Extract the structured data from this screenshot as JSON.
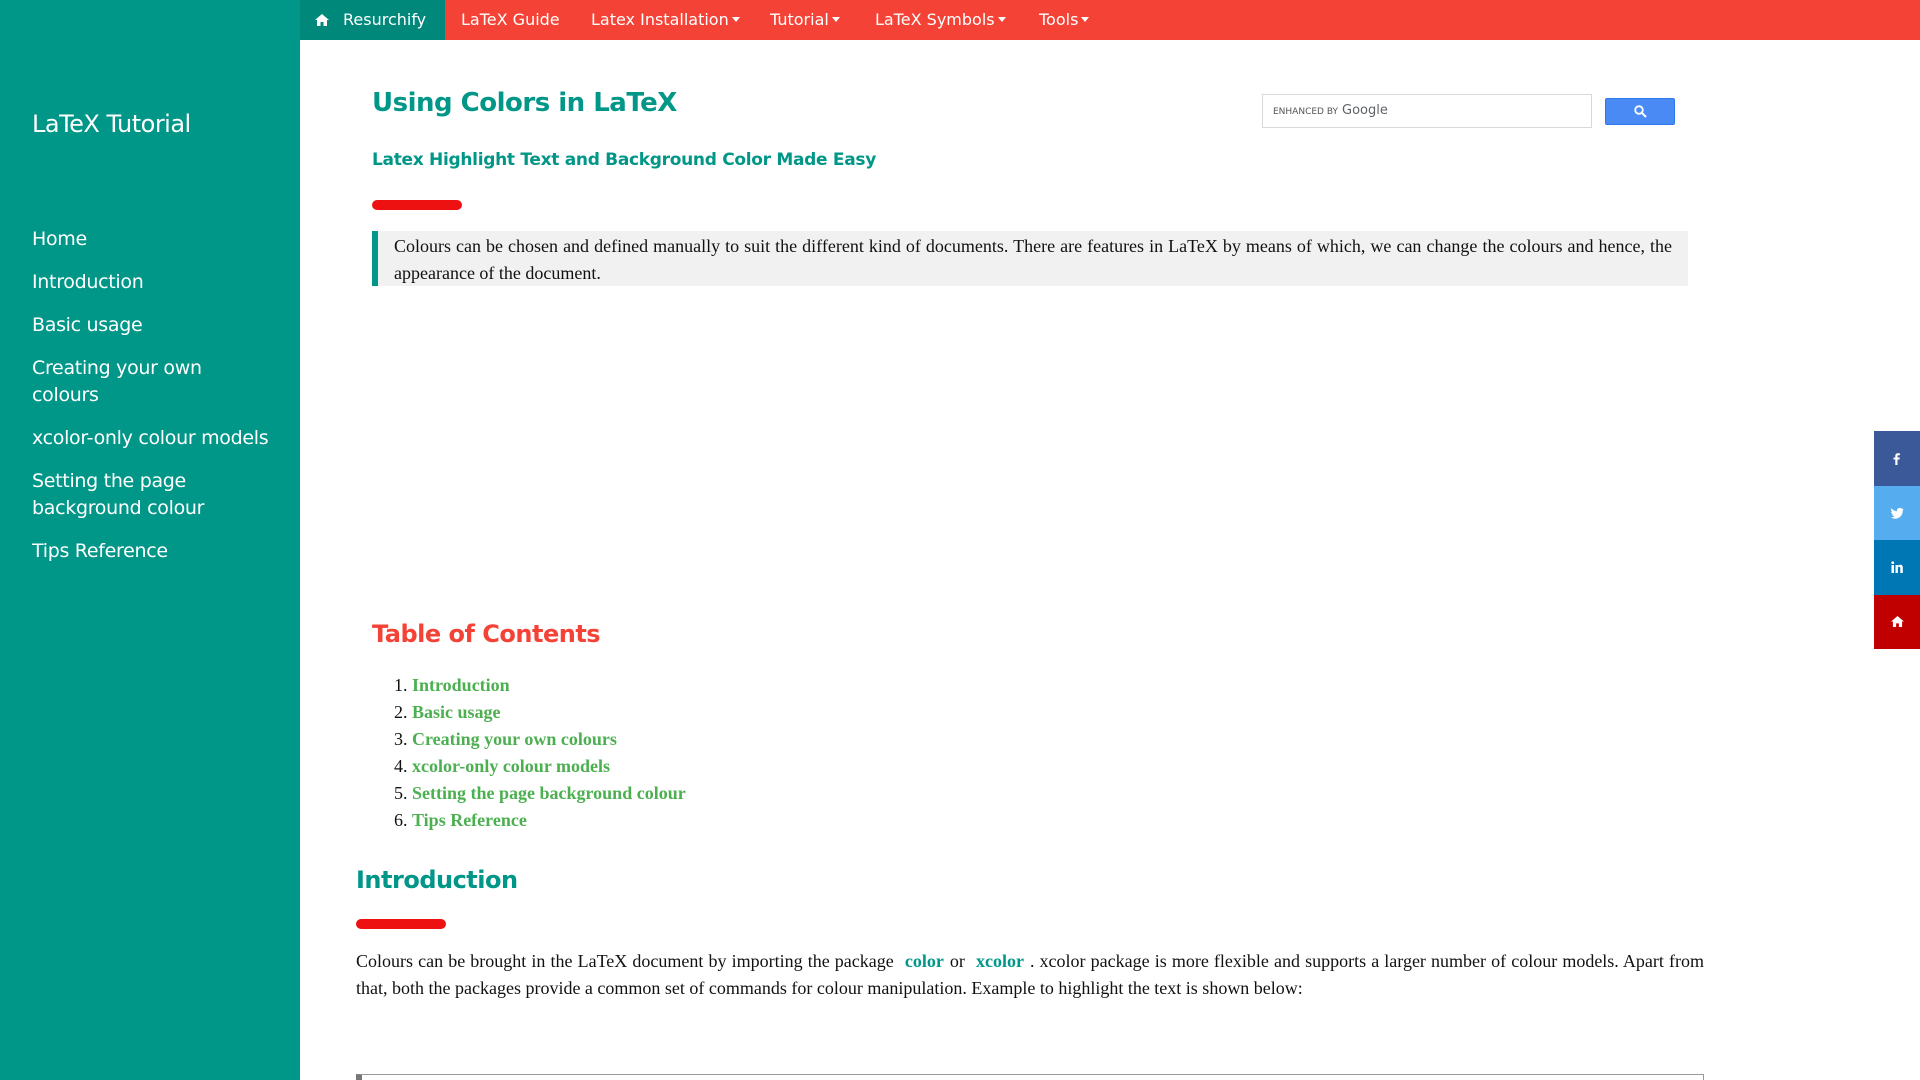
{
  "topnav": {
    "brand": "Resurchify",
    "items": [
      {
        "label": "LaTeX Guide",
        "dropdown": false
      },
      {
        "label": "Latex Installation",
        "dropdown": true
      },
      {
        "label": "Tutorial",
        "dropdown": true
      },
      {
        "label": "LaTeX Symbols",
        "dropdown": true
      },
      {
        "label": "Tools",
        "dropdown": true
      }
    ],
    "colors": {
      "bar": "#f44336",
      "home": "#00897b"
    }
  },
  "sidebar": {
    "title": "LaTeX Tutorial",
    "items": [
      {
        "label": "Home"
      },
      {
        "label": "Introduction"
      },
      {
        "label": "Basic usage"
      },
      {
        "label": "Creating your own colours"
      },
      {
        "label": "xcolor-only colour models"
      },
      {
        "label": "Setting the page background colour"
      },
      {
        "label": "Tips Reference"
      }
    ],
    "color": "#009688"
  },
  "search": {
    "brand_prefix": "ENHANCED BY",
    "brand_name": "Google",
    "placeholder": "",
    "icon": "search-icon"
  },
  "article": {
    "title": "Using Colors in LaTeX",
    "subtitle": "Latex Highlight Text and Background Color Made Easy",
    "intro_quote": "Colours can be chosen and defined manually to suit the different kind of documents. There are features in LaTeX by means of which, we can change the colours and hence, the appearance of the document.",
    "toc": {
      "title": "Table of Contents",
      "items": [
        {
          "number": "1.",
          "label": "Introduction"
        },
        {
          "number": "2.",
          "label": "Basic usage"
        },
        {
          "number": "3.",
          "label": "Creating your own colours"
        },
        {
          "number": "4.",
          "label": "xcolor-only colour models"
        },
        {
          "number": "5.",
          "label": "Setting the page background colour"
        },
        {
          "number": "6.",
          "label": "Tips Reference"
        }
      ]
    },
    "intro": {
      "heading": "Introduction",
      "text_before": "Colours can be brought in the LaTeX document by importing the package",
      "link_color": "color",
      "text_or": "or",
      "link_xcolor": "xcolor",
      "text_after": ". xcolor package is more flexible and supports a larger number of colour models. Apart from that, both the packages provide a common set of commands for colour manipulation. Example to highlight the text is shown below:"
    },
    "colors": {
      "heading": "#009688",
      "toc_title": "#f44336",
      "toc_link": "#4caf50",
      "accent_bar": "#ee1111"
    }
  },
  "social": [
    {
      "icon": "facebook-icon",
      "color": "#3b5998"
    },
    {
      "icon": "twitter-icon",
      "color": "#55acee"
    },
    {
      "icon": "linkedin-icon",
      "color": "#0077b5"
    },
    {
      "icon": "home-icon",
      "color": "#c00000"
    }
  ]
}
